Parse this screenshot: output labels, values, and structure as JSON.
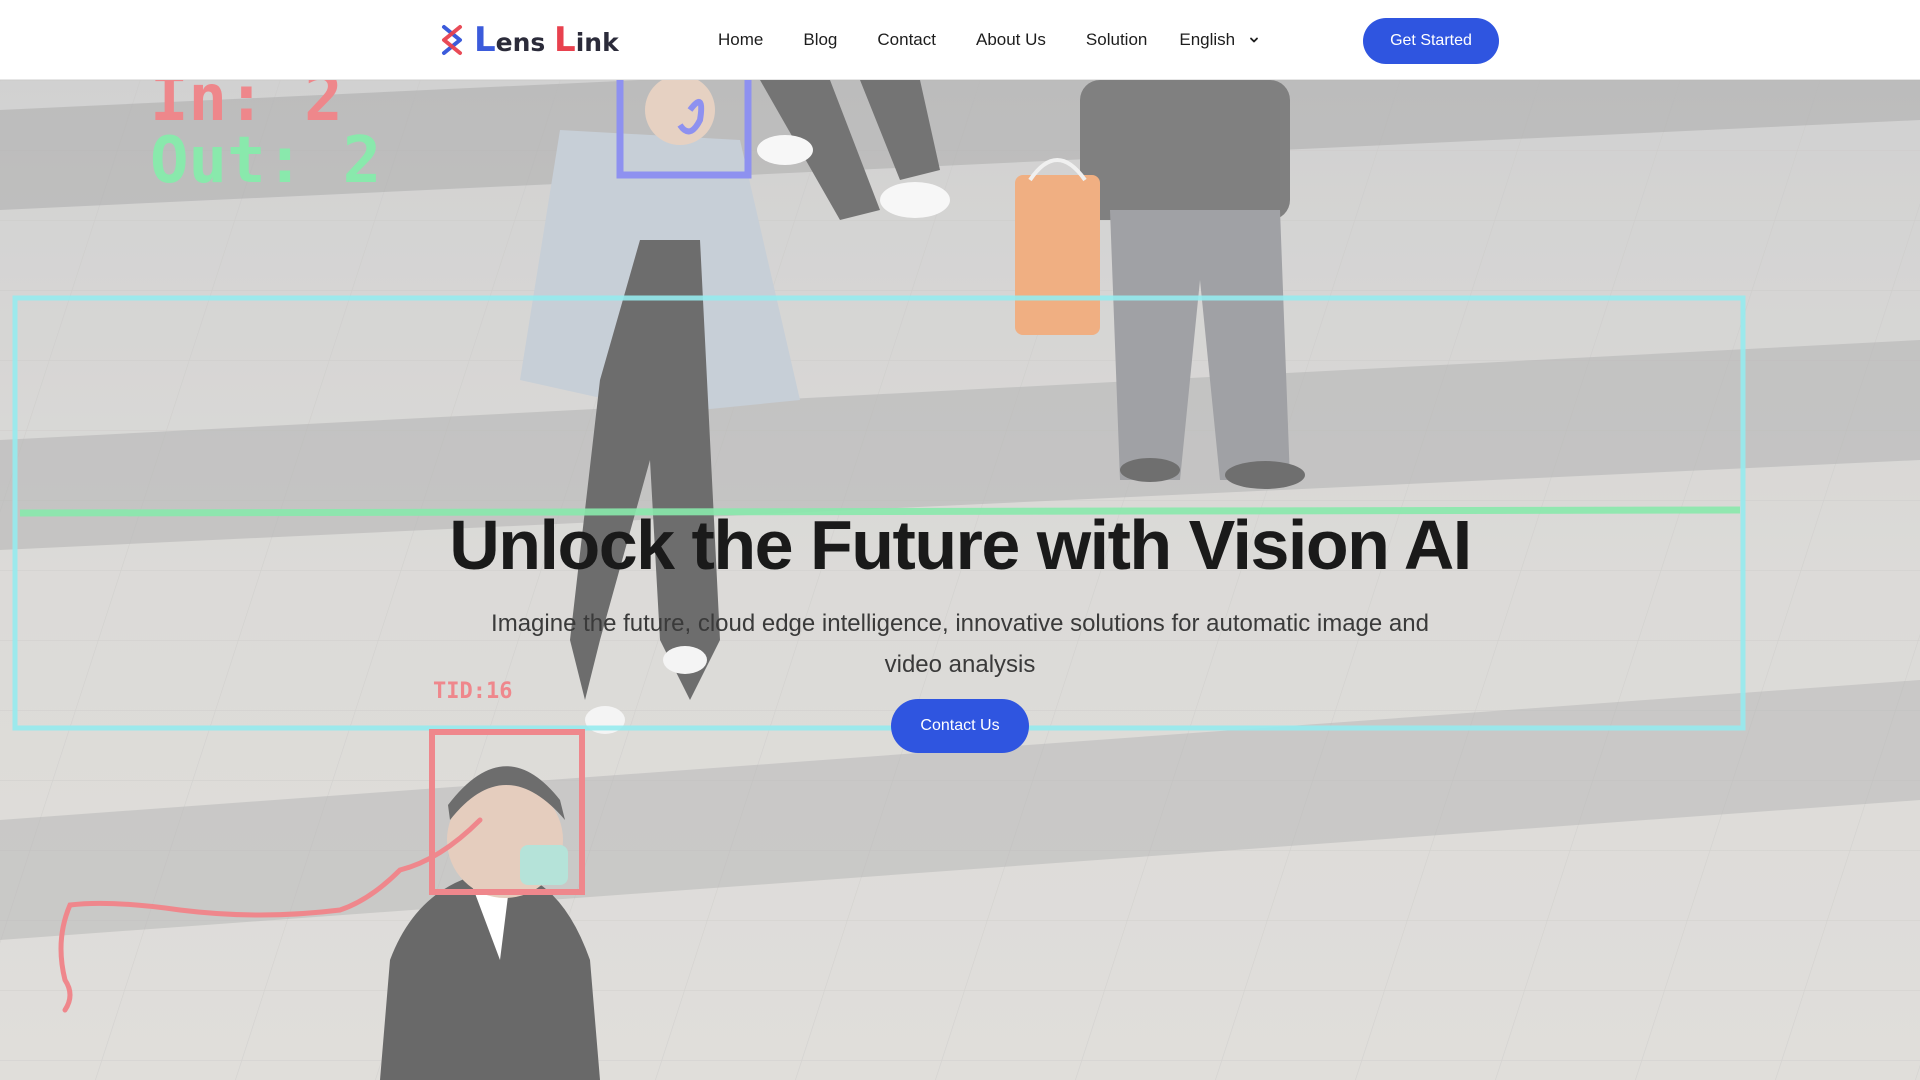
{
  "brand": {
    "name_first_initial": "L",
    "name_first_rest": "ens",
    "name_second_initial": "L",
    "name_second_rest": "ink"
  },
  "nav": {
    "links": [
      "Home",
      "Blog",
      "Contact",
      "About Us",
      "Solution"
    ],
    "language": "English",
    "cta_label": "Get Started"
  },
  "hero": {
    "title": "Unlock the Future with Vision AI",
    "subtitle": "Imagine the future, cloud edge intelligence, innovative solutions for automatic image and video analysis",
    "cta_label": "Contact Us",
    "overlay": {
      "in_label": "In: 2",
      "out_label": "Out: 2",
      "track_id_label": "TID:16"
    }
  },
  "colors": {
    "accent": "#2f55e0",
    "logo_red": "#e8414e",
    "logo_blue": "#3b5bdb",
    "counter_in": "#e5484d",
    "counter_out": "#4ade80",
    "zone_box": "#5de0e6",
    "line": "#4ade80",
    "face_box_blue": "#5256e8",
    "face_box_red": "#e6484f"
  }
}
